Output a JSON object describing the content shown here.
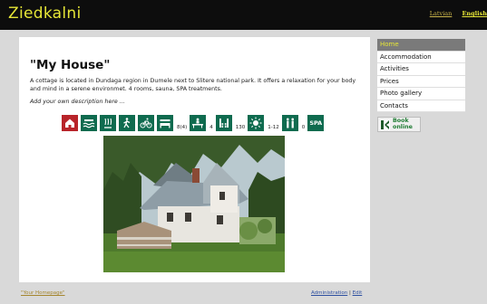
{
  "site": {
    "name": "Ziedkalni"
  },
  "languages": [
    {
      "label": "Latvian",
      "active": false
    },
    {
      "label": "English",
      "active": true
    }
  ],
  "main": {
    "title": "\"My House\"",
    "description": "A cottage is located in Dundaga region in Dumele next to Slitere national park. It offers a relaxation for your body and mind in a serene environmet. 4 rooms, sauna, SPA treatments.",
    "own_description": "Add your own description here ..."
  },
  "amenities": [
    {
      "icon": "house-icon",
      "count": ""
    },
    {
      "icon": "swimming-icon",
      "count": ""
    },
    {
      "icon": "sauna-icon",
      "count": ""
    },
    {
      "icon": "hiking-icon",
      "count": ""
    },
    {
      "icon": "bicycle-icon",
      "count": ""
    },
    {
      "icon": "bed-icon",
      "count": "8(4)"
    },
    {
      "icon": "conference-icon",
      "count": "4"
    },
    {
      "icon": "audience-icon",
      "count": "130"
    },
    {
      "icon": "sun-icon",
      "count": "1-12"
    },
    {
      "icon": "family-icon",
      "count": "0"
    },
    {
      "icon": "spa-icon",
      "count": "",
      "text": "SPA"
    }
  ],
  "menu": [
    {
      "label": "Home",
      "active": true
    },
    {
      "label": "Accommodation",
      "active": false
    },
    {
      "label": "Activities",
      "active": false
    },
    {
      "label": "Prices",
      "active": false
    },
    {
      "label": "Photo gallery",
      "active": false
    },
    {
      "label": "Contacts",
      "active": false
    }
  ],
  "booking": {
    "line1": "Book",
    "line2": "online"
  },
  "footer": {
    "homepage_link": "\"Your Homepage\"",
    "admin_link": "Administration",
    "separator": "|",
    "edit_link": "Edit"
  },
  "colors": {
    "accent": "#e6e637",
    "icon_green": "#0f6b4f",
    "icon_red": "#b8242a"
  }
}
